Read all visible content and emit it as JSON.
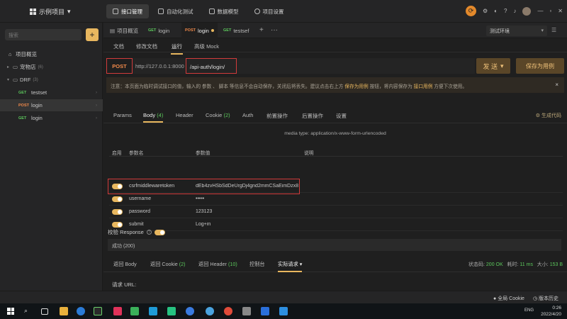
{
  "titlebar": {
    "project_name": "示例项目",
    "nav": [
      {
        "label": "接口管理",
        "active": true
      },
      {
        "label": "自动化测试",
        "active": false
      },
      {
        "label": "数据模型",
        "active": false
      },
      {
        "label": "项目设置",
        "active": false
      }
    ]
  },
  "sidebar": {
    "search_placeholder": "搜索",
    "add_label": "+",
    "items": [
      {
        "label": "项目概览",
        "type": "overview"
      },
      {
        "label": "宠物店",
        "badge": "(6)",
        "type": "folder"
      },
      {
        "label": "DRF",
        "badge": "(3)",
        "type": "folder"
      },
      {
        "method": "GET",
        "label": "testset",
        "type": "api"
      },
      {
        "method": "POST",
        "label": "login",
        "type": "api"
      },
      {
        "method": "GET",
        "label": "login",
        "type": "api"
      }
    ]
  },
  "tabs": [
    {
      "label": "项目概览",
      "method": ""
    },
    {
      "label": "login",
      "method": "GET"
    },
    {
      "label": "login",
      "method": "POST"
    },
    {
      "label": "testsef",
      "method": "GET"
    }
  ],
  "env": {
    "selected": "测试环境"
  },
  "subtabs": [
    "文档",
    "修改文档",
    "运行",
    "高级 Mock"
  ],
  "request": {
    "method": "POST",
    "base_url": "http://127.0.0.1:8000",
    "path": "/api-auth/login/",
    "send_label": "发 送",
    "save_label": "保存为用例"
  },
  "notice": {
    "text1": "注意：本页面为临时调试接口的值，输入的 参数 、 脚本 等信息不会自动保存，关闭后将丢失。建议点击右上方",
    "link1": "保存为用例",
    "text2": "按钮，将内容保存为",
    "link2": "接口用例",
    "text3": "方便下次使用。",
    "close": "×"
  },
  "request_tabs": [
    {
      "label": "Params",
      "count": ""
    },
    {
      "label": "Body",
      "count": "(4)"
    },
    {
      "label": "Header",
      "count": ""
    },
    {
      "label": "Cookie",
      "count": "(2)"
    },
    {
      "label": "Auth",
      "count": ""
    },
    {
      "label": "前置操作",
      "count": ""
    },
    {
      "label": "后置操作",
      "count": ""
    },
    {
      "label": "设置",
      "count": ""
    }
  ],
  "codegen_label": "生成代码",
  "media_type": "media type: application/x-www-form-urlencoded",
  "params_table": {
    "headers": [
      "启用",
      "参数名",
      "参数值",
      "说明"
    ],
    "rows": [
      {
        "name": "csrfmiddlewaretoken",
        "value": "dEb4zvHSbSdDeUrgDj4gnd2mmCSaEimDzx85"
      },
      {
        "name": "username",
        "value": "•••••"
      },
      {
        "name": "password",
        "value": "123123"
      },
      {
        "name": "submit",
        "value": "Log+in"
      }
    ]
  },
  "validate": {
    "label": "校验 Response",
    "help": "?"
  },
  "response_select": "成功 (200)",
  "response_tabs": [
    {
      "label": "返回 Body",
      "count": ""
    },
    {
      "label": "返回 Cookie",
      "count": "(2)"
    },
    {
      "label": "返回 Header",
      "count": "(10)"
    },
    {
      "label": "控制台",
      "count": ""
    },
    {
      "label": "实际请求",
      "count": ""
    }
  ],
  "stats": {
    "status_label": "状态码:",
    "status_value": "200 OK",
    "time_label": "耗时:",
    "time_value": "11 ms",
    "size_label": "大小:",
    "size_value": "153 B"
  },
  "request_url_label": "请求 URL:",
  "statusbar": {
    "cookie_label": "全局 Cookie",
    "version_label": "版本历史"
  },
  "taskbar": {
    "lang": "ENG",
    "time": "0:26",
    "date": "2022/4/20"
  },
  "colors": {
    "accent": "#e8b75f",
    "get": "#5cc85c",
    "post": "#f0894a",
    "highlight_box": "#d23b3b"
  }
}
